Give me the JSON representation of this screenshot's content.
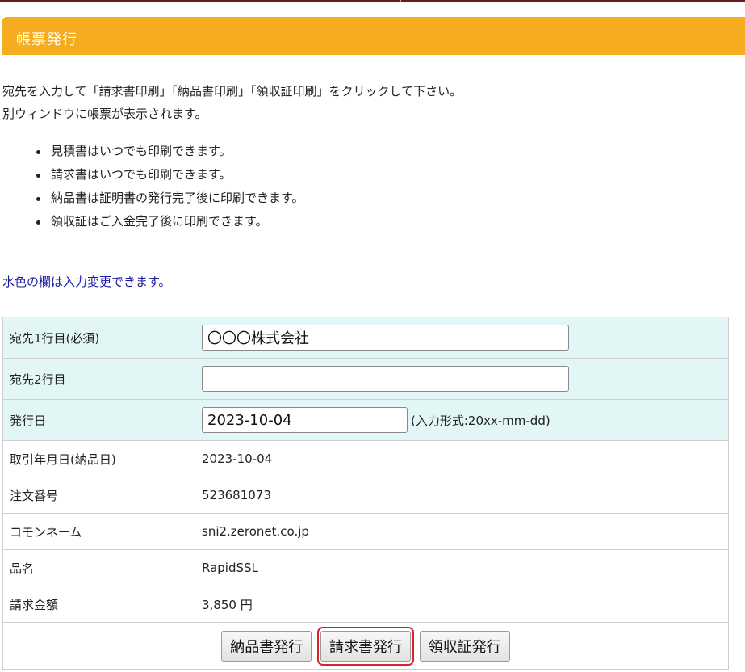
{
  "header": {
    "title": "帳票発行"
  },
  "intro": {
    "line1": "宛先を入力して「請求書印刷」「納品書印刷」「領収証印刷」をクリックして下さい。",
    "line2": "別ウィンドウに帳票が表示されます。"
  },
  "bullets": [
    "見積書はいつでも印刷できます。",
    "請求書はいつでも印刷できます。",
    "納品書は証明書の発行完了後に印刷できます。",
    "領収証はご入金完了後に印刷できます。"
  ],
  "note": "水色の欄は入力変更できます。",
  "form": {
    "address1": {
      "label": "宛先1行目(必須)",
      "value": "〇〇〇株式会社"
    },
    "address2": {
      "label": "宛先2行目",
      "value": ""
    },
    "issue_date": {
      "label": "発行日",
      "value": "2023-10-04",
      "format_hint": "(入力形式:20xx-mm-dd)"
    },
    "rows": [
      {
        "label": "取引年月日(納品日)",
        "value": "2023-10-04"
      },
      {
        "label": "注文番号",
        "value": "523681073"
      },
      {
        "label": "コモンネーム",
        "value": "sni2.zeronet.co.jp"
      },
      {
        "label": "品名",
        "value": "RapidSSL"
      },
      {
        "label": "請求金額",
        "value": "3,850 円"
      }
    ]
  },
  "buttons": {
    "delivery": "納品書発行",
    "invoice": "請求書発行",
    "receipt": "領収証発行"
  },
  "colors": {
    "header_bg": "#f5ac1e",
    "editable_bg": "#e3f6f6",
    "note_text": "#1a1aa0",
    "highlight_border": "#d9232a",
    "top_bar": "#6b1a1a"
  }
}
